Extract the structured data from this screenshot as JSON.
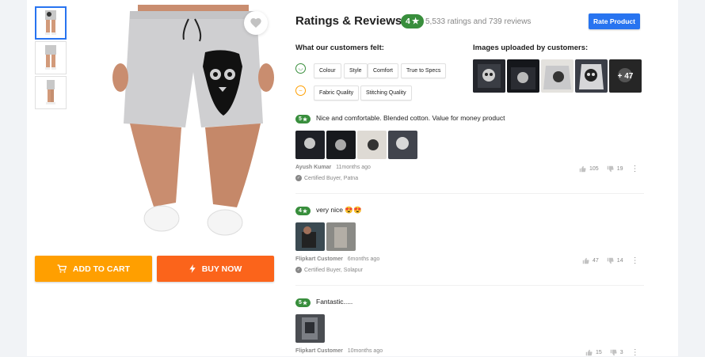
{
  "product": {
    "wishlist_icon": "heart-icon",
    "add_to_cart": "ADD TO CART",
    "buy_now": "BUY NOW"
  },
  "ratings": {
    "title": "Ratings & Reviews",
    "average": "4",
    "summary": "5,533 ratings and 739 reviews",
    "rate_button": "Rate Product",
    "felt_label": "What our customers felt:",
    "positive_tags": [
      "Colour",
      "Style",
      "Comfort",
      "True to Specs"
    ],
    "neutral_tags": [
      "Fabric Quality",
      "Stitching Quality"
    ],
    "images_label": "Images uploaded by customers:",
    "more_images": "+ 47"
  },
  "reviews": [
    {
      "rating": "5",
      "title": "Nice and comfortable. Blended cotton. Value for money product",
      "author": "Ayush Kumar",
      "time": "11months ago",
      "certified": "Certified Buyer, Patna",
      "likes": "105",
      "dislikes": "19"
    },
    {
      "rating": "4",
      "title": "very nice 😍😍",
      "author": "Flipkart Customer",
      "time": "6months ago",
      "certified": "Certified Buyer, Solapur",
      "likes": "47",
      "dislikes": "14"
    },
    {
      "rating": "5",
      "title": "Fantastic.....",
      "author": "Flipkart Customer",
      "time": "10months ago",
      "likes": "15",
      "dislikes": "3"
    }
  ],
  "colors": {
    "brand_blue": "#2874f0",
    "rating_green": "#388e3c",
    "cart_orange": "#ff9f00",
    "buy_orange": "#fb641b"
  }
}
